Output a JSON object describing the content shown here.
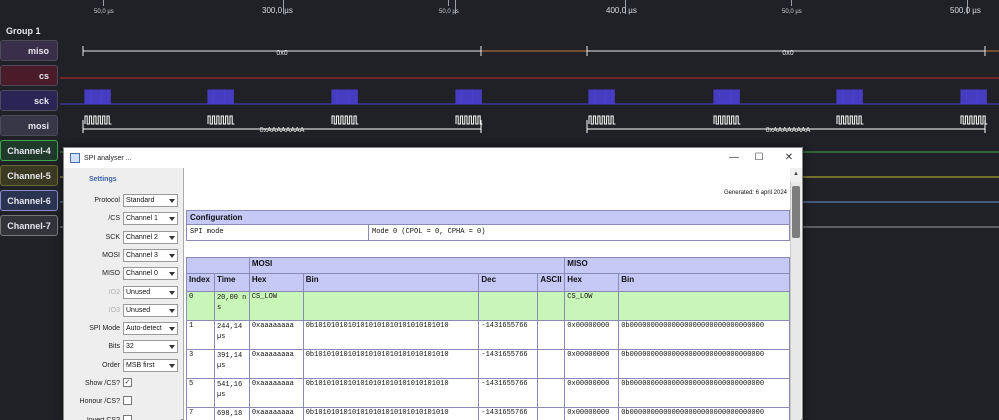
{
  "timeline": {
    "major": [
      {
        "label": "300,0 µs"
      },
      {
        "label": "400,0 µs"
      },
      {
        "label": "500,0 µs"
      }
    ],
    "minor": [
      {
        "label": "50,0 µs"
      },
      {
        "label": "50,0 µs"
      },
      {
        "label": "50,0 µs"
      }
    ]
  },
  "group_label": "Group 1",
  "channels": [
    {
      "name": "miso",
      "color": "#c07a3a",
      "trace": "miso"
    },
    {
      "name": "cs",
      "color": "#c0282b",
      "trace": "cs"
    },
    {
      "name": "sck",
      "color": "#4a3fd1",
      "trace": "sck"
    },
    {
      "name": "mosi",
      "color": "#ffffff",
      "trace": "mosi"
    },
    {
      "name": "Channel-4",
      "color": "#3fa64c",
      "trace": "flat"
    },
    {
      "name": "Channel-5",
      "color": "#c7c03a",
      "trace": "flat"
    },
    {
      "name": "Channel-6",
      "color": "#6a8fd1",
      "trace": "flat"
    },
    {
      "name": "Channel-7",
      "color": "#9a9a9a",
      "trace": "flat"
    }
  ],
  "wave_labels": {
    "miso_value": "0x0",
    "mosi_value": "0xAAAAAAAA"
  },
  "dialog": {
    "title": "SPI analyser ...",
    "minimize": "—",
    "maximize": "☐",
    "close": "✕",
    "settings": {
      "heading": "Settings",
      "rows": [
        {
          "label": "Protocol",
          "value": "Standard",
          "kind": "select",
          "disabled": false
        },
        {
          "label": "/CS",
          "value": "Channel 1",
          "kind": "select",
          "disabled": false
        },
        {
          "label": "SCK",
          "value": "Channel 2",
          "kind": "select",
          "disabled": false
        },
        {
          "label": "MOSI",
          "value": "Channel 3",
          "kind": "select",
          "disabled": false
        },
        {
          "label": "MISO",
          "value": "Channel 0",
          "kind": "select",
          "disabled": false
        },
        {
          "label": "IO2",
          "value": "Unused",
          "kind": "select",
          "disabled": true
        },
        {
          "label": "IO3",
          "value": "Unused",
          "kind": "select",
          "disabled": true
        },
        {
          "label": "SPI Mode",
          "value": "Auto-detect",
          "kind": "select",
          "disabled": false
        },
        {
          "label": "Bits",
          "value": "32",
          "kind": "select",
          "disabled": false
        },
        {
          "label": "Order",
          "value": "MSB first",
          "kind": "select",
          "disabled": false
        },
        {
          "label": "Show /CS?",
          "value": "✓",
          "kind": "checkbox",
          "disabled": false
        },
        {
          "label": "Honour /CS?",
          "value": "",
          "kind": "checkbox",
          "disabled": false
        },
        {
          "label": "Invert CS?",
          "value": "",
          "kind": "checkbox",
          "disabled": false
        }
      ]
    },
    "report": {
      "generated": "Generated: 6 april 2024",
      "config": {
        "heading": "Configuration",
        "key": "SPI mode",
        "value": "Mode 0 (CPOL = 0, CPHA = 0)"
      },
      "groups": {
        "mosi": "MOSI",
        "miso": "MISO"
      },
      "columns": [
        "Index",
        "Time",
        "Hex",
        "Bin",
        "Dec",
        "ASCII",
        "Hex",
        "Bin"
      ],
      "rows": [
        {
          "index": "0",
          "time": "20,00 ns",
          "mosi_hex": "CS_LOW",
          "mosi_bin": "",
          "mosi_dec": "",
          "mosi_ascii": "",
          "miso_hex": "CS_LOW",
          "miso_bin": "",
          "highlight": true
        },
        {
          "index": "1",
          "time": "244,14 µs",
          "mosi_hex": "0xaaaaaaaa",
          "mosi_bin": "0b10101010101010101010101010101010",
          "mosi_dec": "-1431655766",
          "mosi_ascii": "",
          "miso_hex": "0x00000000",
          "miso_bin": "0b00000000000000000000000000000000",
          "highlight": false
        },
        {
          "index": "3",
          "time": "391,14 µs",
          "mosi_hex": "0xaaaaaaaa",
          "mosi_bin": "0b10101010101010101010101010101010",
          "mosi_dec": "-1431655766",
          "mosi_ascii": "",
          "miso_hex": "0x00000000",
          "miso_bin": "0b00000000000000000000000000000000",
          "highlight": false
        },
        {
          "index": "5",
          "time": "541,16 µs",
          "mosi_hex": "0xaaaaaaaa",
          "mosi_bin": "0b10101010101010101010101010101010",
          "mosi_dec": "-1431655766",
          "mosi_ascii": "",
          "miso_hex": "0x00000000",
          "miso_bin": "0b00000000000000000000000000000000",
          "highlight": false
        },
        {
          "index": "7",
          "time": "698,18 µs",
          "mosi_hex": "0xaaaaaaaa",
          "mosi_bin": "0b10101010101010101010101010101010",
          "mosi_dec": "-1431655766",
          "mosi_ascii": "",
          "miso_hex": "0x00000000",
          "miso_bin": "0b00000000000000000000000000000000",
          "highlight": false
        }
      ]
    }
  }
}
